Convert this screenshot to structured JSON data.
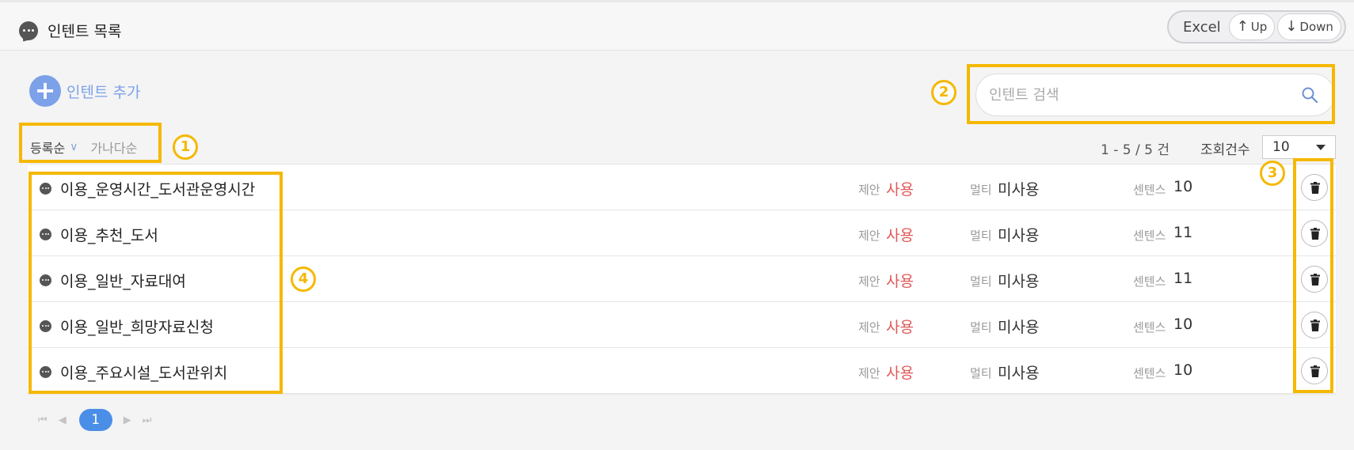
{
  "header": {
    "title": "인텐트 목록",
    "excel_label": "Excel",
    "upload_label": "Up",
    "download_label": "Down"
  },
  "toolbar": {
    "add_label": "인텐트 추가",
    "search_placeholder": "인텐트 검색",
    "sort_options": [
      "등록순",
      "가나다순"
    ],
    "count_text": "1 - 5 / 5 건",
    "per_page_label": "조회건수",
    "per_page_value": "10"
  },
  "list": {
    "suggest_label": "제안",
    "multi_label": "멀티",
    "sentence_label": "센텐스",
    "rows": [
      {
        "name": "이용_운영시간_도서관운영시간",
        "suggest": "사용",
        "multi": "미사용",
        "sentences": "10"
      },
      {
        "name": "이용_추천_도서",
        "suggest": "사용",
        "multi": "미사용",
        "sentences": "11"
      },
      {
        "name": "이용_일반_자료대여",
        "suggest": "사용",
        "multi": "미사용",
        "sentences": "11"
      },
      {
        "name": "이용_일반_희망자료신청",
        "suggest": "사용",
        "multi": "미사용",
        "sentences": "10"
      },
      {
        "name": "이용_주요시설_도서관위치",
        "suggest": "사용",
        "multi": "미사용",
        "sentences": "10"
      }
    ]
  },
  "pagination": {
    "current_page": "1"
  },
  "annotations": [
    "1",
    "2",
    "3",
    "4"
  ],
  "colors": {
    "accent_blue": "#7da1e8",
    "annotation_yellow": "#f5b800",
    "status_red": "#e25959",
    "page_active": "#4a8ee8"
  },
  "icons": [
    "chat-bubble-icon",
    "plus-icon",
    "search-icon",
    "trash-icon",
    "arrow-up-icon",
    "arrow-down-icon",
    "chevron-down-icon",
    "first-page-icon",
    "prev-page-icon",
    "next-page-icon",
    "last-page-icon"
  ]
}
